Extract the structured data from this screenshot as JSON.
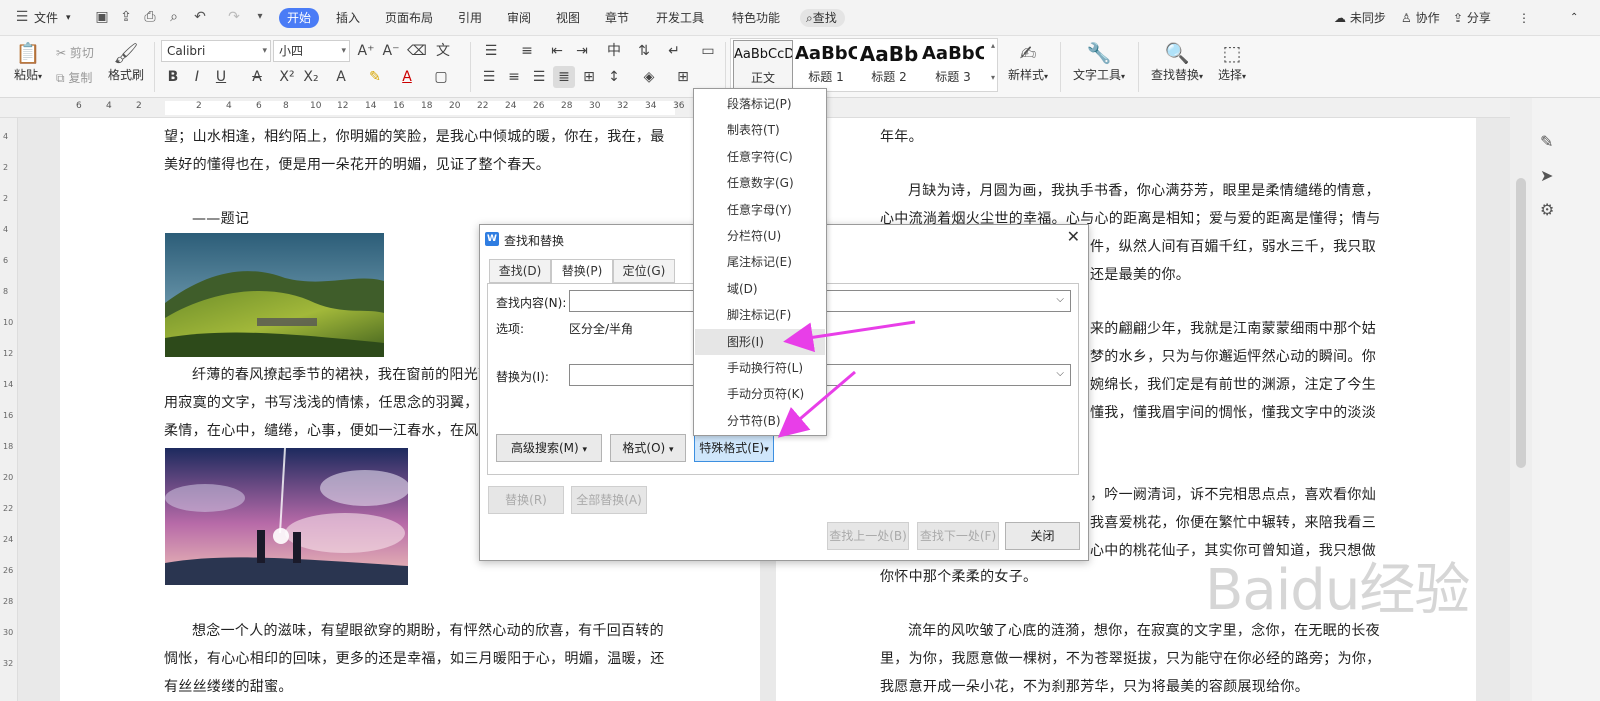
{
  "menubar": {
    "file": "文件",
    "tabs": [
      "开始",
      "插入",
      "页面布局",
      "引用",
      "审阅",
      "视图",
      "章节",
      "开发工具",
      "特色功能"
    ],
    "search": "查找",
    "sync": "未同步",
    "collab": "协作",
    "share": "分享"
  },
  "ribbon": {
    "paste": "粘贴",
    "cut": "剪切",
    "copy": "复制",
    "format_painter": "格式刷",
    "font_name": "Calibri",
    "font_size": "小四",
    "styles": [
      {
        "sample": "AaBbCcD",
        "name": "正文"
      },
      {
        "sample": "AaBbC",
        "name": "标题 1"
      },
      {
        "sample": "AaBb",
        "name": "标题 2"
      },
      {
        "sample": "AaBbC",
        "name": "标题 3"
      }
    ],
    "new_style": "新样式",
    "text_tools": "文字工具",
    "find_replace": "查找替换",
    "select": "选择"
  },
  "ruler": {
    "numbers": [
      "6",
      "4",
      "2",
      "2",
      "4",
      "6",
      "8",
      "10",
      "12",
      "14",
      "16",
      "18",
      "20",
      "22",
      "24",
      "26",
      "28",
      "30",
      "32",
      "34",
      "36"
    ]
  },
  "vruler": {
    "numbers": [
      "4",
      "2",
      "2",
      "4",
      "6",
      "8",
      "10",
      "12",
      "14",
      "16",
      "18",
      "20",
      "22",
      "24",
      "26",
      "28",
      "30",
      "32"
    ]
  },
  "doc_left": {
    "lines": [
      "望；山水相逢，相约陌上，你明媚的笑脸，是我心中倾城的暖，你在，我在，最",
      "美好的懂得也在，便是用一朵花开的明媚，见证了整个春天。",
      "——题记",
      "纤薄的春风撩起季节的裙袂，我在窗前的阳光下",
      "用寂寞的文字，书写浅浅的情愫，任思念的羽翼，",
      "柔情，在心中，缱绻，心事，便如一江春水，在风中",
      "想念一个人的滋味，有望眼欲穿的期盼，有怦然心动的欣喜，有千回百转的",
      "惆怅，有心心相印的回味，更多的还是幸福，如三月暖阳于心，明媚，温暖，还",
      "有丝丝缕缕的甜蜜。"
    ]
  },
  "doc_right": {
    "lines": [
      "年年。",
      "月缺为诗，月圆为画，我执手书香，你心满芬芳，眼里是柔情缱绻的情意，",
      "心中流淌着烟火尘世的幸福。心与心的距离是相知；爱与爱的距离是懂得；情与",
      "件，纵然人间有百媚千红，弱水三千，我只取",
      "还是最美的你。",
      "来的翩翩少年，我就是江南蒙蒙细雨中那个姑",
      "梦的水乡，只为与你邂逅怦然心动的瞬间。你",
      "婉绵长，我们定是有前世的渊源，注定了今生",
      "懂我，懂我眉宇间的惆怅，懂我文字中的淡淡",
      "，吟一阙清词，诉不完相思点点，喜欢看你灿",
      "我喜爱桃花，你便在繁忙中辗转，来陪我看三",
      "心中的桃花仙子，其实你可曾知道，我只想做",
      "你怀中那个柔柔的女子。",
      "流年的风吹皱了心底的涟漪，想你，在寂寞的文字里，念你，在无眠的长夜",
      "里，为你，我愿意做一棵树，不为苍翠挺拔，只为能守在你必经的路旁；为你，",
      "我愿意开成一朵小花，不为刹那芳华，只为将最美的容颜展现给你。"
    ]
  },
  "dialog": {
    "title": "查找和替换",
    "tabs": [
      "查找(D)",
      "替换(P)",
      "定位(G)"
    ],
    "find_label": "查找内容(N):",
    "options_label": "选项:",
    "options_value": "区分全/半角",
    "replace_label": "替换为(I):",
    "btn_advanced": "高级搜索(M)",
    "btn_format": "格式(O)",
    "btn_special": "特殊格式(E)",
    "btn_replace": "替换(R)",
    "btn_replace_all": "全部替换(A)",
    "btn_find_prev": "查找上一处(B)",
    "btn_find_next": "查找下一处(F)",
    "btn_close": "关闭"
  },
  "dropdown": {
    "items": [
      "段落标记(P)",
      "制表符(T)",
      "任意字符(C)",
      "任意数字(G)",
      "任意字母(Y)",
      "分栏符(U)",
      "尾注标记(E)",
      "域(D)",
      "脚注标记(F)",
      "图形(I)",
      "手动换行符(L)",
      "手动分页符(K)",
      "分节符(B)"
    ],
    "highlighted_index": 9
  },
  "watermark": {
    "text": "Baidu经验"
  },
  "colors": {
    "accent": "#4a7cf6",
    "arrow": "#e83ee8",
    "highlight": "#e6e6e6"
  }
}
